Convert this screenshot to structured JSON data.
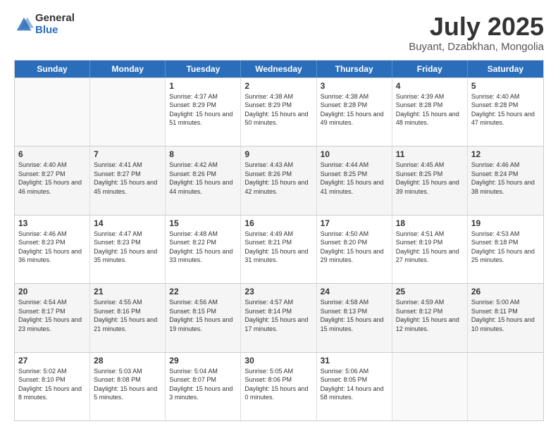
{
  "header": {
    "logo_general": "General",
    "logo_blue": "Blue",
    "month_title": "July 2025",
    "location": "Buyant, Dzabkhan, Mongolia"
  },
  "calendar": {
    "days_of_week": [
      "Sunday",
      "Monday",
      "Tuesday",
      "Wednesday",
      "Thursday",
      "Friday",
      "Saturday"
    ],
    "weeks": [
      [
        {
          "day": "",
          "sunrise": "",
          "sunset": "",
          "daylight": "",
          "empty": true
        },
        {
          "day": "",
          "sunrise": "",
          "sunset": "",
          "daylight": "",
          "empty": true
        },
        {
          "day": "1",
          "sunrise": "Sunrise: 4:37 AM",
          "sunset": "Sunset: 8:29 PM",
          "daylight": "Daylight: 15 hours and 51 minutes."
        },
        {
          "day": "2",
          "sunrise": "Sunrise: 4:38 AM",
          "sunset": "Sunset: 8:29 PM",
          "daylight": "Daylight: 15 hours and 50 minutes."
        },
        {
          "day": "3",
          "sunrise": "Sunrise: 4:38 AM",
          "sunset": "Sunset: 8:28 PM",
          "daylight": "Daylight: 15 hours and 49 minutes."
        },
        {
          "day": "4",
          "sunrise": "Sunrise: 4:39 AM",
          "sunset": "Sunset: 8:28 PM",
          "daylight": "Daylight: 15 hours and 48 minutes."
        },
        {
          "day": "5",
          "sunrise": "Sunrise: 4:40 AM",
          "sunset": "Sunset: 8:28 PM",
          "daylight": "Daylight: 15 hours and 47 minutes."
        }
      ],
      [
        {
          "day": "6",
          "sunrise": "Sunrise: 4:40 AM",
          "sunset": "Sunset: 8:27 PM",
          "daylight": "Daylight: 15 hours and 46 minutes."
        },
        {
          "day": "7",
          "sunrise": "Sunrise: 4:41 AM",
          "sunset": "Sunset: 8:27 PM",
          "daylight": "Daylight: 15 hours and 45 minutes."
        },
        {
          "day": "8",
          "sunrise": "Sunrise: 4:42 AM",
          "sunset": "Sunset: 8:26 PM",
          "daylight": "Daylight: 15 hours and 44 minutes."
        },
        {
          "day": "9",
          "sunrise": "Sunrise: 4:43 AM",
          "sunset": "Sunset: 8:26 PM",
          "daylight": "Daylight: 15 hours and 42 minutes."
        },
        {
          "day": "10",
          "sunrise": "Sunrise: 4:44 AM",
          "sunset": "Sunset: 8:25 PM",
          "daylight": "Daylight: 15 hours and 41 minutes."
        },
        {
          "day": "11",
          "sunrise": "Sunrise: 4:45 AM",
          "sunset": "Sunset: 8:25 PM",
          "daylight": "Daylight: 15 hours and 39 minutes."
        },
        {
          "day": "12",
          "sunrise": "Sunrise: 4:46 AM",
          "sunset": "Sunset: 8:24 PM",
          "daylight": "Daylight: 15 hours and 38 minutes."
        }
      ],
      [
        {
          "day": "13",
          "sunrise": "Sunrise: 4:46 AM",
          "sunset": "Sunset: 8:23 PM",
          "daylight": "Daylight: 15 hours and 36 minutes."
        },
        {
          "day": "14",
          "sunrise": "Sunrise: 4:47 AM",
          "sunset": "Sunset: 8:23 PM",
          "daylight": "Daylight: 15 hours and 35 minutes."
        },
        {
          "day": "15",
          "sunrise": "Sunrise: 4:48 AM",
          "sunset": "Sunset: 8:22 PM",
          "daylight": "Daylight: 15 hours and 33 minutes."
        },
        {
          "day": "16",
          "sunrise": "Sunrise: 4:49 AM",
          "sunset": "Sunset: 8:21 PM",
          "daylight": "Daylight: 15 hours and 31 minutes."
        },
        {
          "day": "17",
          "sunrise": "Sunrise: 4:50 AM",
          "sunset": "Sunset: 8:20 PM",
          "daylight": "Daylight: 15 hours and 29 minutes."
        },
        {
          "day": "18",
          "sunrise": "Sunrise: 4:51 AM",
          "sunset": "Sunset: 8:19 PM",
          "daylight": "Daylight: 15 hours and 27 minutes."
        },
        {
          "day": "19",
          "sunrise": "Sunrise: 4:53 AM",
          "sunset": "Sunset: 8:18 PM",
          "daylight": "Daylight: 15 hours and 25 minutes."
        }
      ],
      [
        {
          "day": "20",
          "sunrise": "Sunrise: 4:54 AM",
          "sunset": "Sunset: 8:17 PM",
          "daylight": "Daylight: 15 hours and 23 minutes."
        },
        {
          "day": "21",
          "sunrise": "Sunrise: 4:55 AM",
          "sunset": "Sunset: 8:16 PM",
          "daylight": "Daylight: 15 hours and 21 minutes."
        },
        {
          "day": "22",
          "sunrise": "Sunrise: 4:56 AM",
          "sunset": "Sunset: 8:15 PM",
          "daylight": "Daylight: 15 hours and 19 minutes."
        },
        {
          "day": "23",
          "sunrise": "Sunrise: 4:57 AM",
          "sunset": "Sunset: 8:14 PM",
          "daylight": "Daylight: 15 hours and 17 minutes."
        },
        {
          "day": "24",
          "sunrise": "Sunrise: 4:58 AM",
          "sunset": "Sunset: 8:13 PM",
          "daylight": "Daylight: 15 hours and 15 minutes."
        },
        {
          "day": "25",
          "sunrise": "Sunrise: 4:59 AM",
          "sunset": "Sunset: 8:12 PM",
          "daylight": "Daylight: 15 hours and 12 minutes."
        },
        {
          "day": "26",
          "sunrise": "Sunrise: 5:00 AM",
          "sunset": "Sunset: 8:11 PM",
          "daylight": "Daylight: 15 hours and 10 minutes."
        }
      ],
      [
        {
          "day": "27",
          "sunrise": "Sunrise: 5:02 AM",
          "sunset": "Sunset: 8:10 PM",
          "daylight": "Daylight: 15 hours and 8 minutes."
        },
        {
          "day": "28",
          "sunrise": "Sunrise: 5:03 AM",
          "sunset": "Sunset: 8:08 PM",
          "daylight": "Daylight: 15 hours and 5 minutes."
        },
        {
          "day": "29",
          "sunrise": "Sunrise: 5:04 AM",
          "sunset": "Sunset: 8:07 PM",
          "daylight": "Daylight: 15 hours and 3 minutes."
        },
        {
          "day": "30",
          "sunrise": "Sunrise: 5:05 AM",
          "sunset": "Sunset: 8:06 PM",
          "daylight": "Daylight: 15 hours and 0 minutes."
        },
        {
          "day": "31",
          "sunrise": "Sunrise: 5:06 AM",
          "sunset": "Sunset: 8:05 PM",
          "daylight": "Daylight: 14 hours and 58 minutes."
        },
        {
          "day": "",
          "sunrise": "",
          "sunset": "",
          "daylight": "",
          "empty": true
        },
        {
          "day": "",
          "sunrise": "",
          "sunset": "",
          "daylight": "",
          "empty": true
        }
      ]
    ]
  }
}
